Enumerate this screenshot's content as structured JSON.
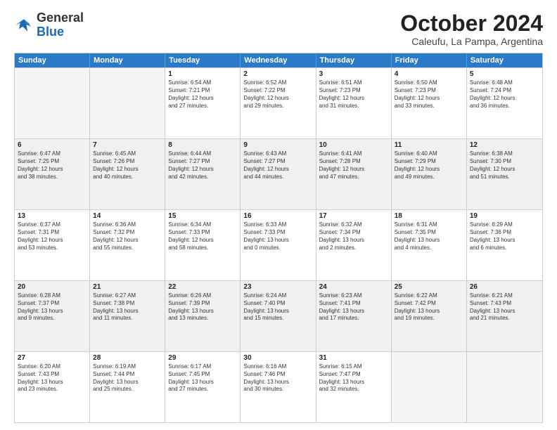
{
  "logo": {
    "general": "General",
    "blue": "Blue"
  },
  "title": "October 2024",
  "subtitle": "Caleufu, La Pampa, Argentina",
  "headers": [
    "Sunday",
    "Monday",
    "Tuesday",
    "Wednesday",
    "Thursday",
    "Friday",
    "Saturday"
  ],
  "rows": [
    [
      {
        "day": "",
        "lines": [],
        "empty": true
      },
      {
        "day": "",
        "lines": [],
        "empty": true
      },
      {
        "day": "1",
        "lines": [
          "Sunrise: 6:54 AM",
          "Sunset: 7:21 PM",
          "Daylight: 12 hours",
          "and 27 minutes."
        ]
      },
      {
        "day": "2",
        "lines": [
          "Sunrise: 6:52 AM",
          "Sunset: 7:22 PM",
          "Daylight: 12 hours",
          "and 29 minutes."
        ]
      },
      {
        "day": "3",
        "lines": [
          "Sunrise: 6:51 AM",
          "Sunset: 7:23 PM",
          "Daylight: 12 hours",
          "and 31 minutes."
        ]
      },
      {
        "day": "4",
        "lines": [
          "Sunrise: 6:50 AM",
          "Sunset: 7:23 PM",
          "Daylight: 12 hours",
          "and 33 minutes."
        ]
      },
      {
        "day": "5",
        "lines": [
          "Sunrise: 6:48 AM",
          "Sunset: 7:24 PM",
          "Daylight: 12 hours",
          "and 36 minutes."
        ]
      }
    ],
    [
      {
        "day": "6",
        "lines": [
          "Sunrise: 6:47 AM",
          "Sunset: 7:25 PM",
          "Daylight: 12 hours",
          "and 38 minutes."
        ]
      },
      {
        "day": "7",
        "lines": [
          "Sunrise: 6:45 AM",
          "Sunset: 7:26 PM",
          "Daylight: 12 hours",
          "and 40 minutes."
        ]
      },
      {
        "day": "8",
        "lines": [
          "Sunrise: 6:44 AM",
          "Sunset: 7:27 PM",
          "Daylight: 12 hours",
          "and 42 minutes."
        ]
      },
      {
        "day": "9",
        "lines": [
          "Sunrise: 6:43 AM",
          "Sunset: 7:27 PM",
          "Daylight: 12 hours",
          "and 44 minutes."
        ]
      },
      {
        "day": "10",
        "lines": [
          "Sunrise: 6:41 AM",
          "Sunset: 7:28 PM",
          "Daylight: 12 hours",
          "and 47 minutes."
        ]
      },
      {
        "day": "11",
        "lines": [
          "Sunrise: 6:40 AM",
          "Sunset: 7:29 PM",
          "Daylight: 12 hours",
          "and 49 minutes."
        ]
      },
      {
        "day": "12",
        "lines": [
          "Sunrise: 6:38 AM",
          "Sunset: 7:30 PM",
          "Daylight: 12 hours",
          "and 51 minutes."
        ]
      }
    ],
    [
      {
        "day": "13",
        "lines": [
          "Sunrise: 6:37 AM",
          "Sunset: 7:31 PM",
          "Daylight: 12 hours",
          "and 53 minutes."
        ]
      },
      {
        "day": "14",
        "lines": [
          "Sunrise: 6:36 AM",
          "Sunset: 7:32 PM",
          "Daylight: 12 hours",
          "and 55 minutes."
        ]
      },
      {
        "day": "15",
        "lines": [
          "Sunrise: 6:34 AM",
          "Sunset: 7:33 PM",
          "Daylight: 12 hours",
          "and 58 minutes."
        ]
      },
      {
        "day": "16",
        "lines": [
          "Sunrise: 6:33 AM",
          "Sunset: 7:33 PM",
          "Daylight: 13 hours",
          "and 0 minutes."
        ]
      },
      {
        "day": "17",
        "lines": [
          "Sunrise: 6:32 AM",
          "Sunset: 7:34 PM",
          "Daylight: 13 hours",
          "and 2 minutes."
        ]
      },
      {
        "day": "18",
        "lines": [
          "Sunrise: 6:31 AM",
          "Sunset: 7:35 PM",
          "Daylight: 13 hours",
          "and 4 minutes."
        ]
      },
      {
        "day": "19",
        "lines": [
          "Sunrise: 6:29 AM",
          "Sunset: 7:36 PM",
          "Daylight: 13 hours",
          "and 6 minutes."
        ]
      }
    ],
    [
      {
        "day": "20",
        "lines": [
          "Sunrise: 6:28 AM",
          "Sunset: 7:37 PM",
          "Daylight: 13 hours",
          "and 9 minutes."
        ]
      },
      {
        "day": "21",
        "lines": [
          "Sunrise: 6:27 AM",
          "Sunset: 7:38 PM",
          "Daylight: 13 hours",
          "and 11 minutes."
        ]
      },
      {
        "day": "22",
        "lines": [
          "Sunrise: 6:26 AM",
          "Sunset: 7:39 PM",
          "Daylight: 13 hours",
          "and 13 minutes."
        ]
      },
      {
        "day": "23",
        "lines": [
          "Sunrise: 6:24 AM",
          "Sunset: 7:40 PM",
          "Daylight: 13 hours",
          "and 15 minutes."
        ]
      },
      {
        "day": "24",
        "lines": [
          "Sunrise: 6:23 AM",
          "Sunset: 7:41 PM",
          "Daylight: 13 hours",
          "and 17 minutes."
        ]
      },
      {
        "day": "25",
        "lines": [
          "Sunrise: 6:22 AM",
          "Sunset: 7:42 PM",
          "Daylight: 13 hours",
          "and 19 minutes."
        ]
      },
      {
        "day": "26",
        "lines": [
          "Sunrise: 6:21 AM",
          "Sunset: 7:43 PM",
          "Daylight: 13 hours",
          "and 21 minutes."
        ]
      }
    ],
    [
      {
        "day": "27",
        "lines": [
          "Sunrise: 6:20 AM",
          "Sunset: 7:43 PM",
          "Daylight: 13 hours",
          "and 23 minutes."
        ]
      },
      {
        "day": "28",
        "lines": [
          "Sunrise: 6:19 AM",
          "Sunset: 7:44 PM",
          "Daylight: 13 hours",
          "and 25 minutes."
        ]
      },
      {
        "day": "29",
        "lines": [
          "Sunrise: 6:17 AM",
          "Sunset: 7:45 PM",
          "Daylight: 13 hours",
          "and 27 minutes."
        ]
      },
      {
        "day": "30",
        "lines": [
          "Sunrise: 6:16 AM",
          "Sunset: 7:46 PM",
          "Daylight: 13 hours",
          "and 30 minutes."
        ]
      },
      {
        "day": "31",
        "lines": [
          "Sunrise: 6:15 AM",
          "Sunset: 7:47 PM",
          "Daylight: 13 hours",
          "and 32 minutes."
        ]
      },
      {
        "day": "",
        "lines": [],
        "empty": true
      },
      {
        "day": "",
        "lines": [],
        "empty": true
      }
    ]
  ]
}
